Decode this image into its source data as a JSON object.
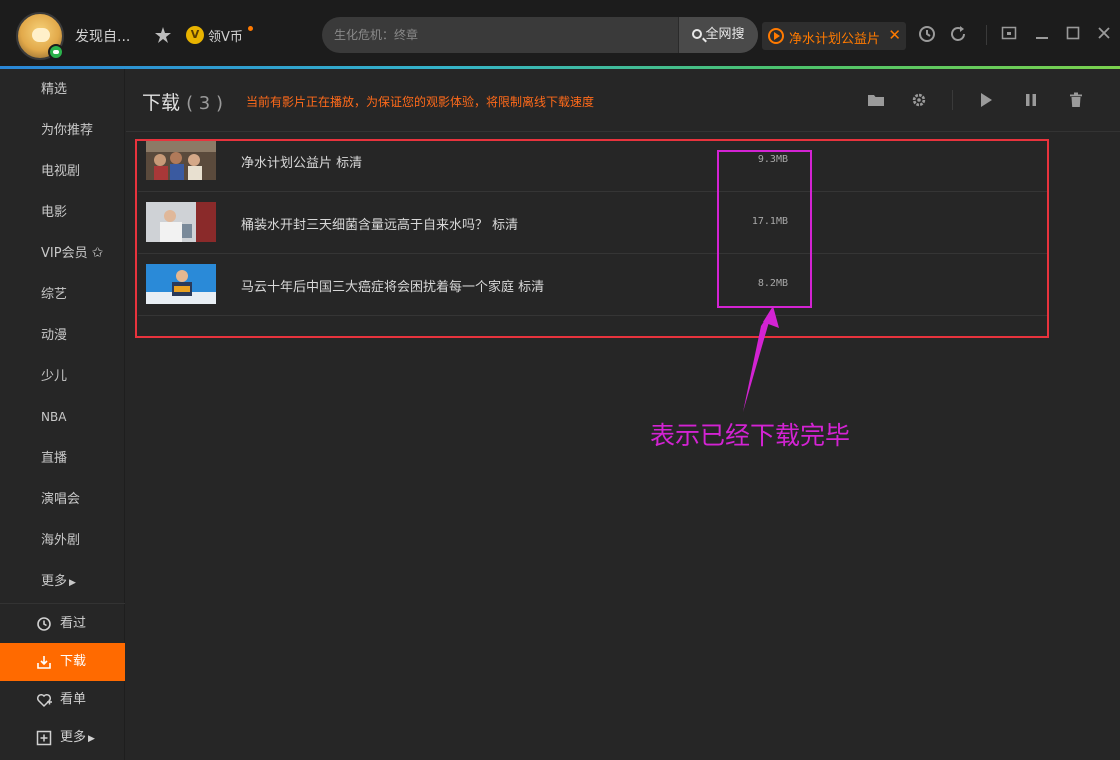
{
  "header": {
    "username": "发现自...",
    "vcoin_symbol": "V",
    "vcoin_label": "领V币",
    "search_placeholder": "生化危机：终章",
    "search_button": "全网搜",
    "playing_tab": "净水计划公益片",
    "playing_close": "✕"
  },
  "sidebar": {
    "items": [
      {
        "label": "精选"
      },
      {
        "label": "为你推荐"
      },
      {
        "label": "电视剧"
      },
      {
        "label": "电影"
      },
      {
        "label": "VIP会员"
      },
      {
        "label": "综艺"
      },
      {
        "label": "动漫"
      },
      {
        "label": "少儿"
      },
      {
        "label": "NBA"
      },
      {
        "label": "直播"
      },
      {
        "label": "演唱会"
      },
      {
        "label": "海外剧"
      },
      {
        "label": "更多"
      }
    ],
    "bottom": [
      {
        "label": "看过",
        "icon": "history-icon"
      },
      {
        "label": "下载",
        "icon": "download-icon",
        "active": true
      },
      {
        "label": "看单",
        "icon": "heart-plus-icon"
      },
      {
        "label": "更多",
        "icon": "plus-box-icon"
      }
    ]
  },
  "main": {
    "title": "下载",
    "count": "( 3 )",
    "notice": "当前有影片正在播放，为保证您的观影体验，将限制离线下载速度",
    "downloads": [
      {
        "title": "净水计划公益片 标清",
        "size": "9.3MB"
      },
      {
        "title": "桶装水开封三天细菌含量远高于自来水吗？ 标清",
        "size": "17.1MB"
      },
      {
        "title": "马云十年后中国三大癌症将会困扰着每一个家庭 标清",
        "size": "8.2MB"
      }
    ]
  },
  "annotation": {
    "text": "表示已经下载完毕"
  },
  "colors": {
    "accent": "#ff6a00",
    "notice": "#ff6a1a",
    "annotation": "#d323d3",
    "highlight_box": "#e8333d"
  }
}
